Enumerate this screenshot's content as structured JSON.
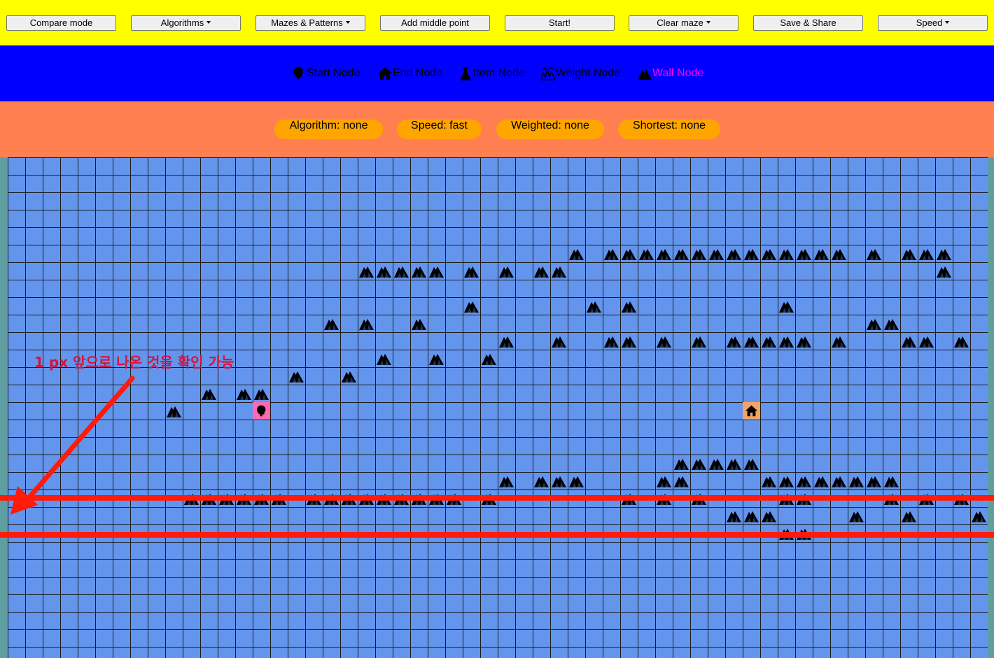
{
  "toolbar": {
    "buttons": [
      {
        "label": "Compare mode",
        "dropdown": false
      },
      {
        "label": "Algorithms",
        "dropdown": true
      },
      {
        "label": "Mazes & Patterns",
        "dropdown": true
      },
      {
        "label": "Add middle point",
        "dropdown": false
      },
      {
        "label": "Start!",
        "dropdown": false
      },
      {
        "label": "Clear maze",
        "dropdown": true
      },
      {
        "label": "Save & Share",
        "dropdown": false
      },
      {
        "label": "Speed",
        "dropdown": true
      }
    ]
  },
  "legend": [
    {
      "label": "Start Node",
      "icon": "head-icon"
    },
    {
      "label": "End Node",
      "icon": "house-icon"
    },
    {
      "label": "Item Node",
      "icon": "flask-icon"
    },
    {
      "label": "Weight Node",
      "icon": "weight-icon"
    },
    {
      "label": "Wall Node",
      "icon": "mountain-icon"
    }
  ],
  "info": {
    "algorithm": "Algorithm: none",
    "speed": "Speed: fast",
    "weighted": "Weighted: none",
    "shortest": "Shortest: none"
  },
  "annotation": {
    "text": "1 px 앞으로 나온 것을 확인 가능"
  },
  "colors": {
    "toolbar": "#ffff00",
    "legend_bar": "#0000ff",
    "info_bar": "#ff7f50",
    "pill": "#ffa500",
    "grid": "#6495ed",
    "start": "#ff69b4",
    "end": "#f4a460",
    "highlight": "#ff1a0a",
    "annotation": "#d2143c"
  }
}
